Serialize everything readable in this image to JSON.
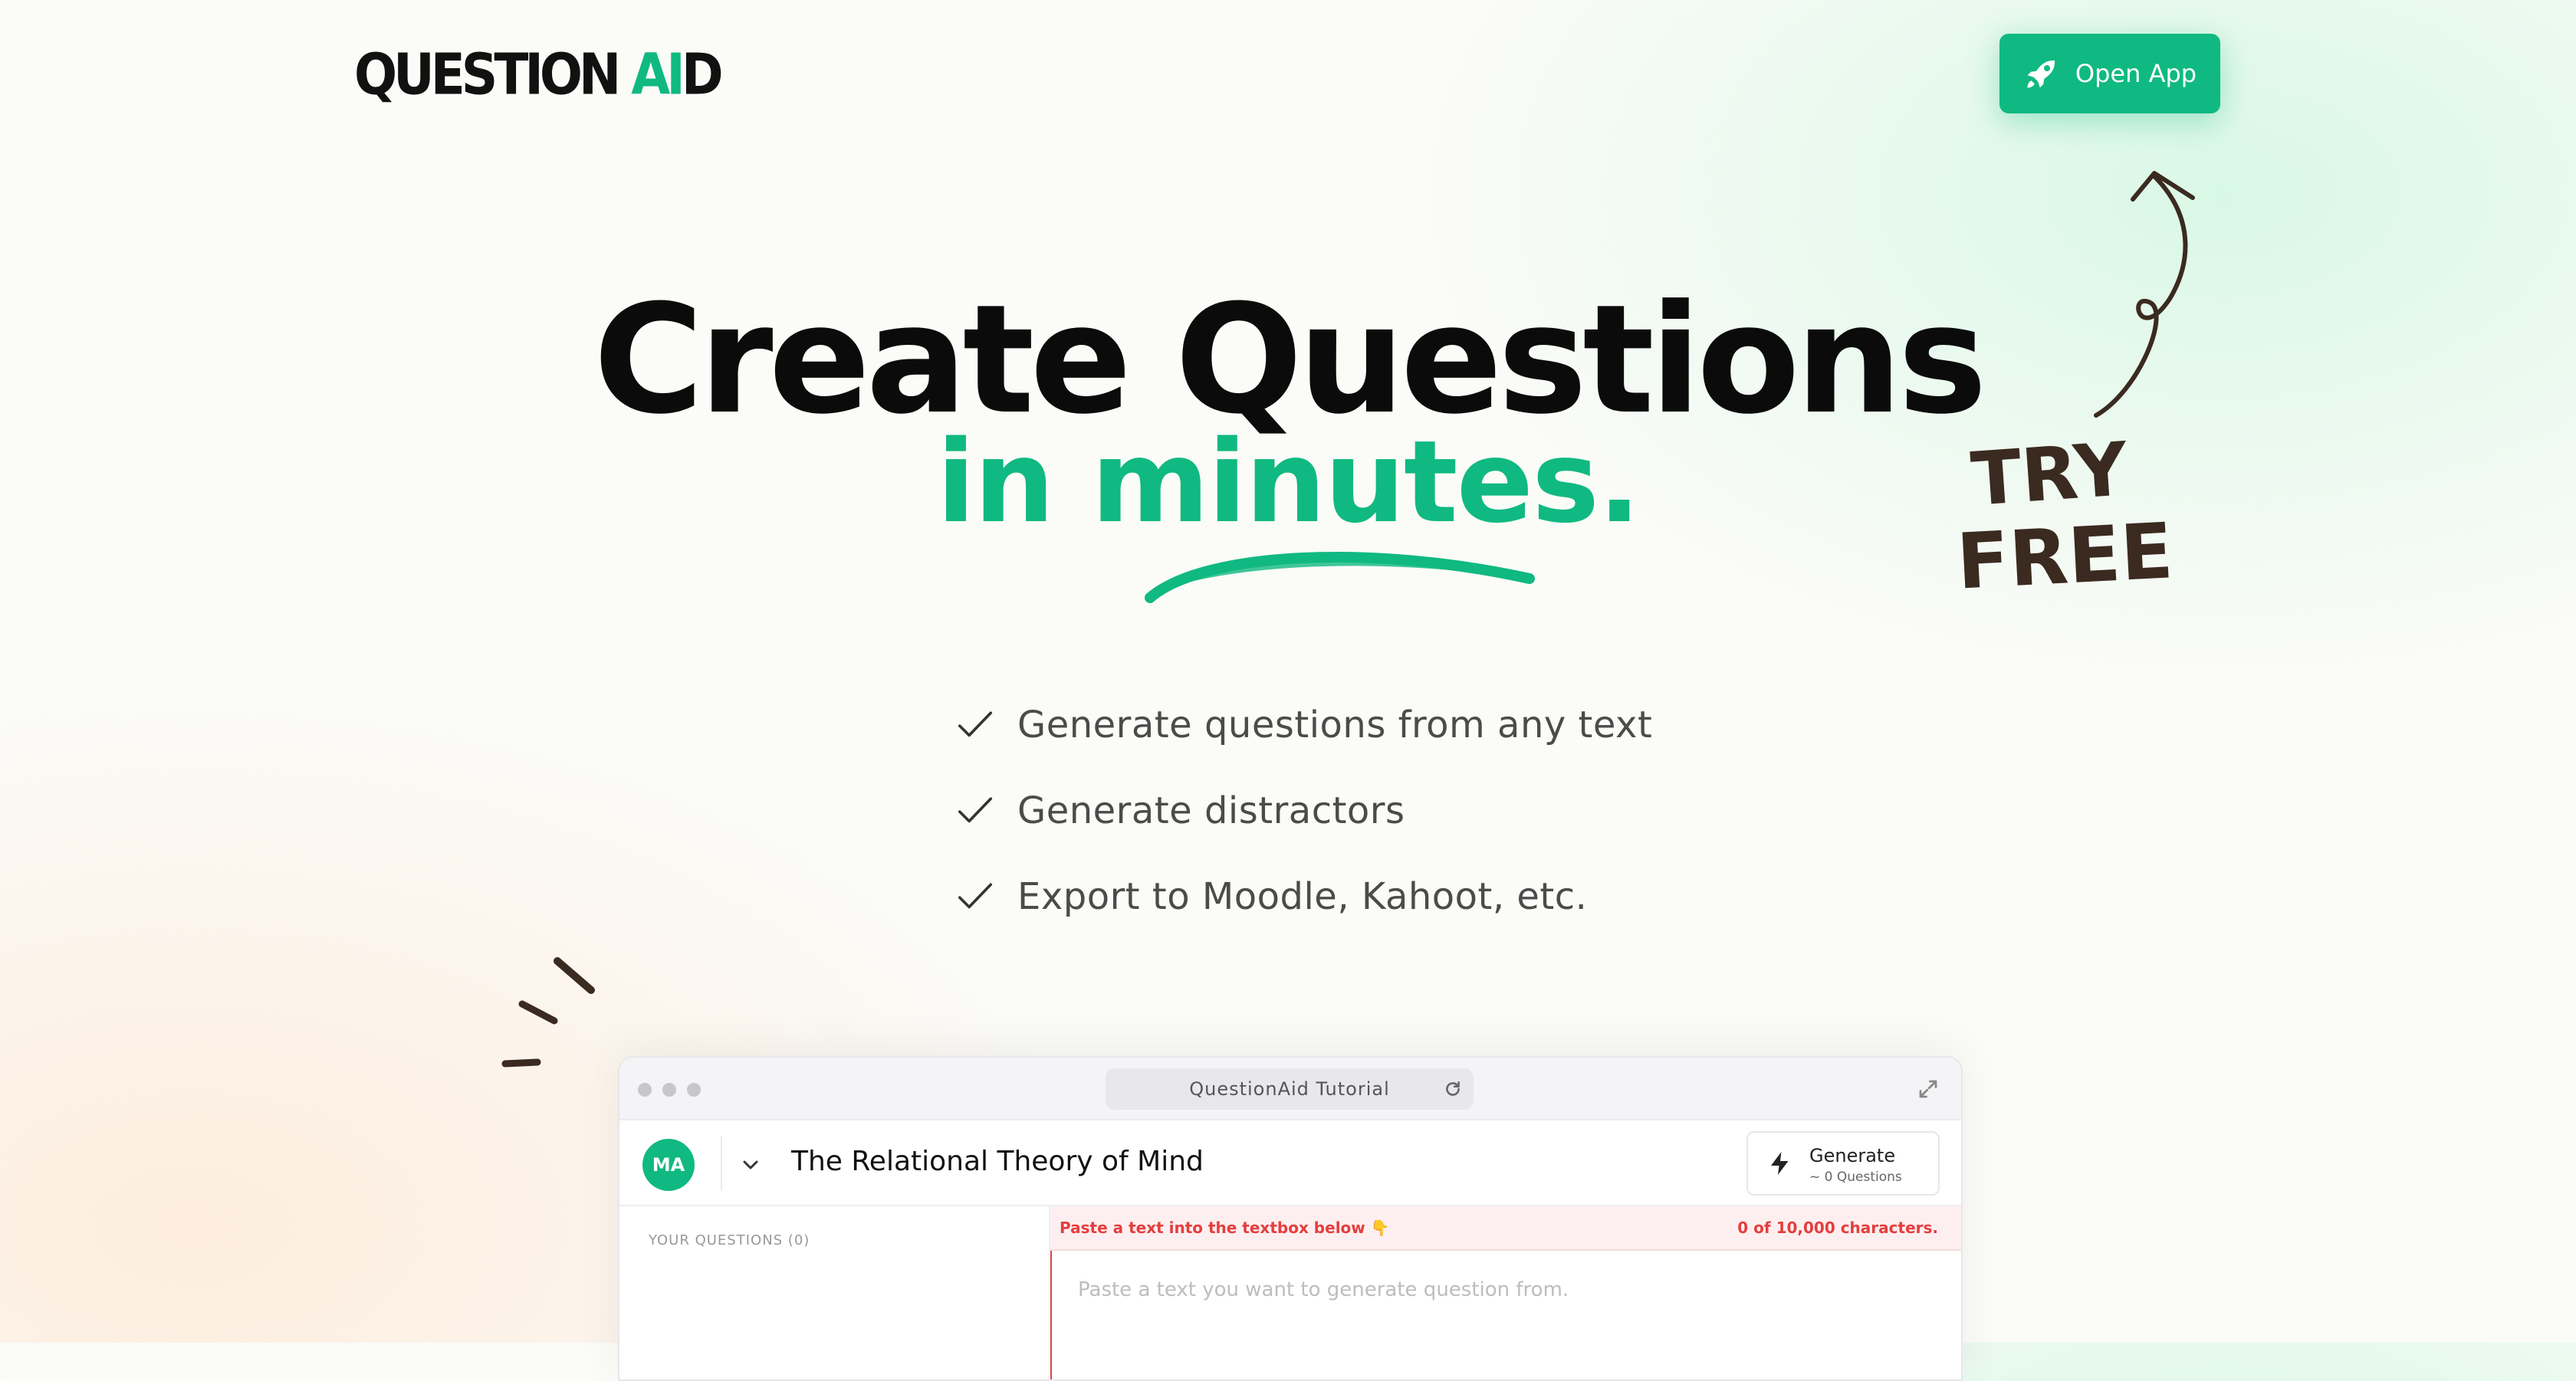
{
  "brand": {
    "logo_part1": "QUESTION ",
    "logo_ai": "AI",
    "logo_d": "D"
  },
  "header": {
    "cta_label": "Open App",
    "cta_icon": "rocket-icon"
  },
  "hero": {
    "title": "Create Questions",
    "subtitle": "in minutes.",
    "accent_color": "#10b981"
  },
  "features": [
    {
      "label": "Generate questions from any text"
    },
    {
      "label": "Generate distractors"
    },
    {
      "label": "Export to Moodle, Kahoot, etc."
    }
  ],
  "try_free": {
    "line1": "TRY",
    "line2": "FREE"
  },
  "app_preview": {
    "address_text": "QuestionAid Tutorial",
    "avatar_initials": "MA",
    "document_title": "The Relational Theory of Mind",
    "generate_label": "Generate",
    "generate_sub": "~ 0 Questions",
    "questions_label": "YOUR QUESTIONS (0)",
    "warning_text": "Paste a text into the textbox below 👇",
    "char_count": "0 of 10,000 characters.",
    "textarea_placeholder": "Paste a text you want to generate question from."
  }
}
